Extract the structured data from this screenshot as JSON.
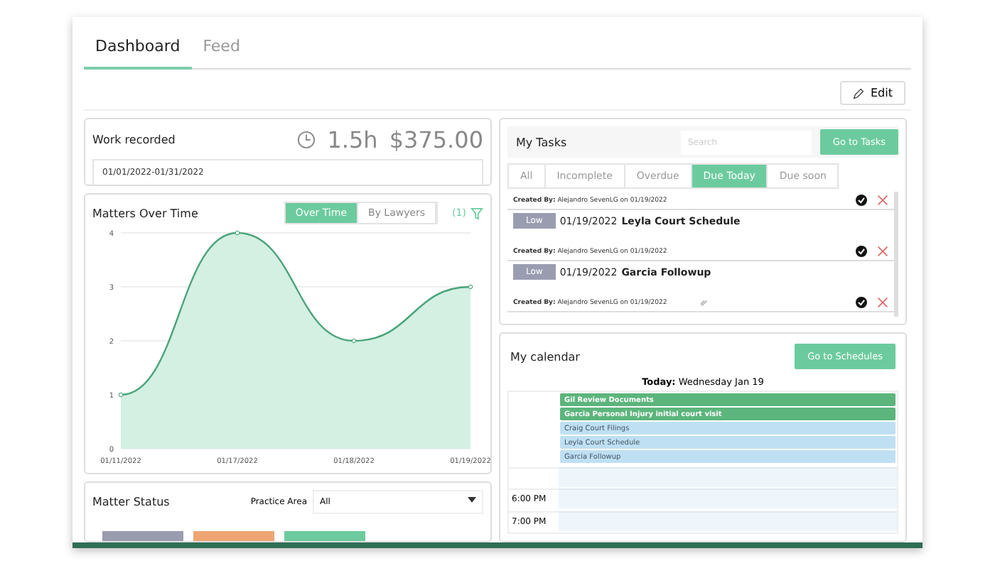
{
  "tabs": [
    {
      "label": "Dashboard",
      "selected": true
    },
    {
      "label": "Feed",
      "selected": false
    }
  ],
  "edit_button": "Edit",
  "work_recorded": {
    "title": "Work recorded",
    "hours": "1.5h",
    "amount": "$375.00",
    "date_range": "01/01/2022-01/31/2022"
  },
  "matters_over_time": {
    "title": "Matters Over Time",
    "toggle": [
      {
        "label": "Over Time",
        "selected": true
      },
      {
        "label": "By Lawyers",
        "selected": false
      }
    ],
    "filter_count": "(1)",
    "chart_data": {
      "type": "area",
      "categories": [
        "01/11/2022",
        "01/17/2022",
        "01/18/2022",
        "01/19/2022"
      ],
      "values": [
        1,
        4,
        2,
        3
      ],
      "ylim": [
        0,
        4
      ],
      "yticks": [
        0,
        1,
        2,
        3,
        4
      ]
    }
  },
  "matter_status": {
    "title": "Matter Status",
    "practice_area_label": "Practice Area",
    "practice_area_value": "All",
    "tiles": [
      {
        "color": "#9a9db0"
      },
      {
        "color": "#eea574"
      },
      {
        "color": "#6ccb9e"
      }
    ]
  },
  "my_tasks": {
    "title": "My Tasks",
    "search_placeholder": "Search",
    "button": "Go to Tasks",
    "filters": [
      {
        "label": "All",
        "selected": false
      },
      {
        "label": "Incomplete",
        "selected": false
      },
      {
        "label": "Overdue",
        "selected": false
      },
      {
        "label": "Due Today",
        "selected": true
      },
      {
        "label": "Due soon",
        "selected": false
      }
    ],
    "tasks": [
      {
        "created": "**Created By:** Alejandro SevenLG on 01/19/2022",
        "attachment": false
      },
      {
        "priority": "Low",
        "date": "01/19/2022",
        "title": "Leyla Court Schedule",
        "created": "**Created By:** Alejandro SevenLG on 01/19/2022",
        "attachment": false
      },
      {
        "priority": "Low",
        "date": "01/19/2022",
        "title": "Garcia Followup",
        "created": "**Created By:** Alejandro SevenLG on 01/19/2022",
        "attachment": true
      }
    ]
  },
  "my_calendar": {
    "title": "My calendar",
    "button": "Go to Schedules",
    "today_label": "Today:",
    "today": "Wednesday Jan 19",
    "events": [
      {
        "title": "Gil Review Documents",
        "color": "#5cb57c"
      },
      {
        "title": "Garcia Personal Injury initial court visit",
        "color": "#5cb57c"
      },
      {
        "title": "Craig Court Filings",
        "color": "#bfe0f3"
      },
      {
        "title": "Leyla Court Schedule",
        "color": "#bfe0f3"
      },
      {
        "title": "Garcia Followup",
        "color": "#bfe0f3"
      }
    ],
    "times": [
      "6:00 PM",
      "7:00 PM"
    ]
  }
}
